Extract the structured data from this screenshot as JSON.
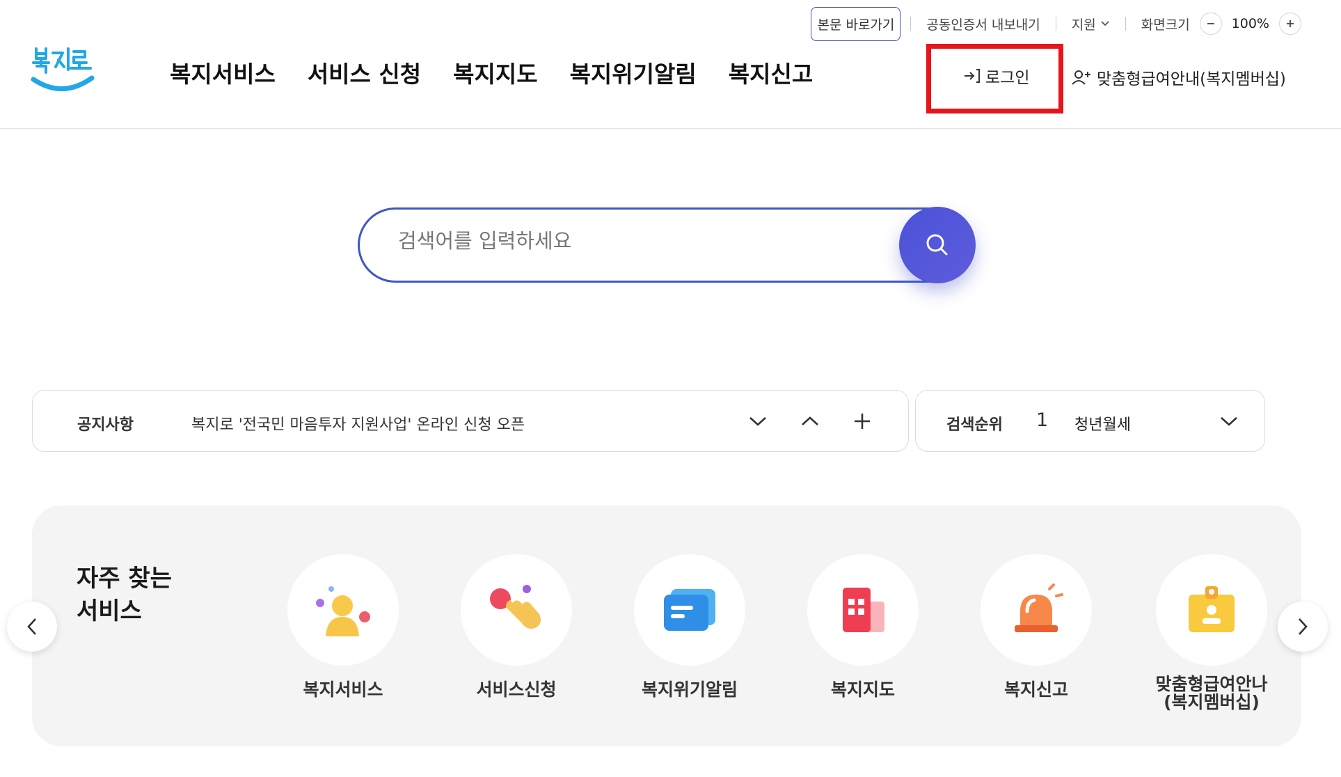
{
  "util": {
    "skip_label": "본문 바로가기",
    "cert_label": "공동인증서 내보내기",
    "support_label": "지원",
    "zoom_label": "화면크기",
    "zoom_value": "100%"
  },
  "logo": {
    "text": "복지로"
  },
  "nav": {
    "items": [
      "복지서비스",
      "서비스 신청",
      "복지지도",
      "복지위기알림",
      "복지신고"
    ]
  },
  "account": {
    "login_label": "로그인",
    "membership_label": "맞춤형급여안내(복지멤버십)"
  },
  "search": {
    "placeholder": "검색어를 입력하세요"
  },
  "notice": {
    "label": "공지사항",
    "text": "복지로 '전국민 마음투자 지원사업' 온라인 신청 오픈"
  },
  "rank": {
    "label": "검색순위",
    "number": "1",
    "text": "청년월세"
  },
  "favorites": {
    "title_line1": "자주 찾는",
    "title_line2": "서비스",
    "items": [
      {
        "label": "복지서비스",
        "icon": "person-icon"
      },
      {
        "label": "서비스신청",
        "icon": "hand-tap-icon"
      },
      {
        "label": "복지위기알림",
        "icon": "message-icon"
      },
      {
        "label": "복지지도",
        "icon": "map-icon"
      },
      {
        "label": "복지신고",
        "icon": "siren-icon"
      },
      {
        "label_line1": "맞춤형급여안나",
        "label_line2": "(복지멤버십)",
        "icon": "id-badge-icon"
      }
    ]
  },
  "colors": {
    "brand_blue": "#3d57c7",
    "logo_blue": "#22a7e8",
    "highlight_red": "#e8141b",
    "panel_gray": "#f4f4f4"
  }
}
